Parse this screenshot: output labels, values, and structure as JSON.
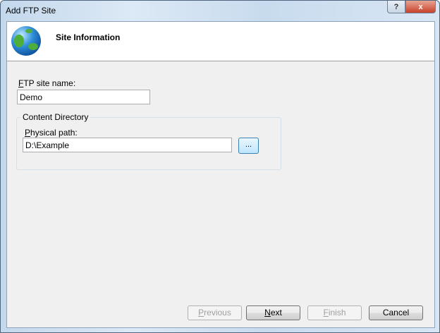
{
  "window": {
    "title": "Add FTP Site",
    "help_label": "?",
    "close_label": "x"
  },
  "header": {
    "title": "Site Information",
    "icon": "globe-icon"
  },
  "form": {
    "site_name_label_accel": "F",
    "site_name_label_rest": "TP site name:",
    "site_name_value": "Demo",
    "group_label": "Content Directory",
    "path_label_accel": "P",
    "path_label_rest": "hysical path:",
    "path_value": "D:\\Example",
    "browse_label": "..."
  },
  "buttons": {
    "previous_accel": "P",
    "previous_rest": "revious",
    "next_accel": "N",
    "next_rest": "ext",
    "finish_accel": "F",
    "finish_rest": "inish",
    "cancel": "Cancel"
  }
}
